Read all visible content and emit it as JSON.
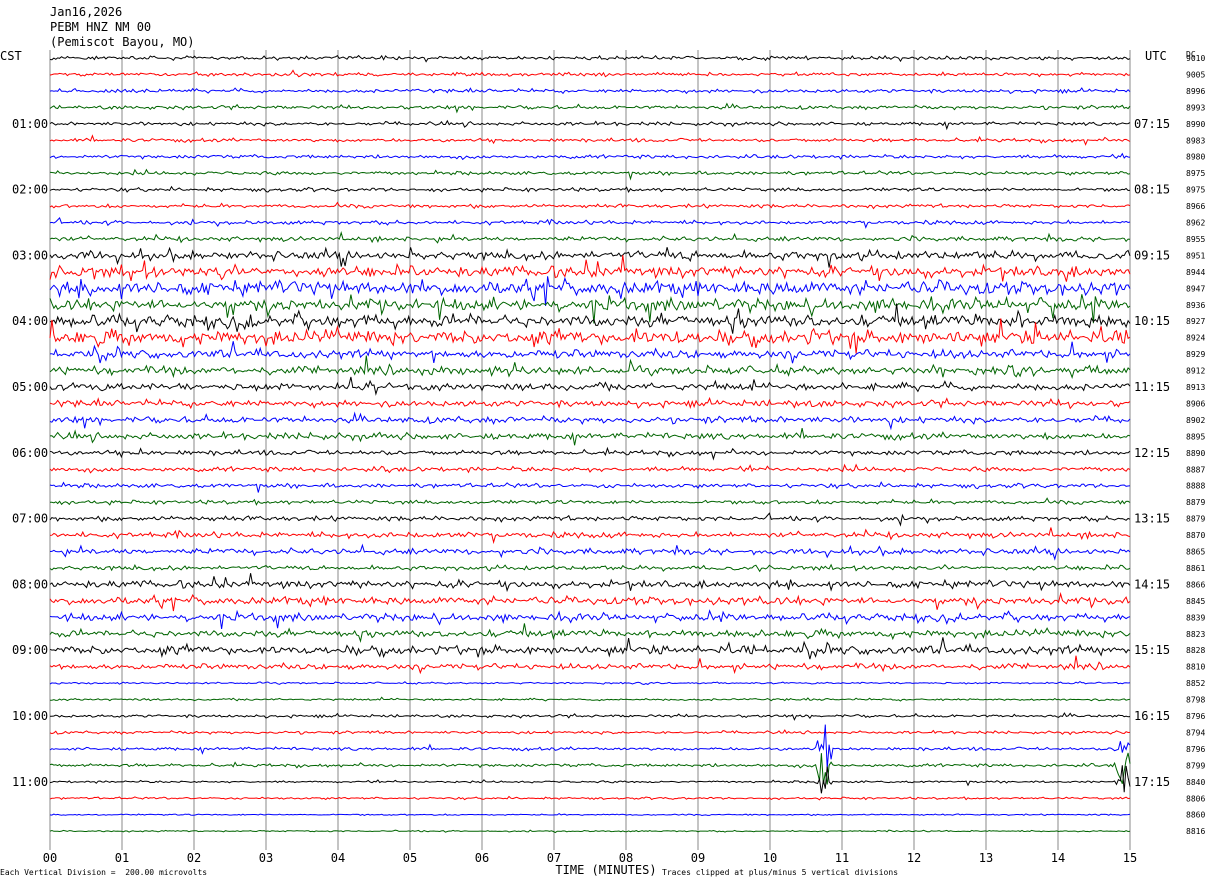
{
  "header": {
    "date": "Jan16,2026",
    "station": "PEBM HNZ NM 00",
    "location": "(Pemiscot Bayou, MO)"
  },
  "left_zone": "CST",
  "right_zone": "UTC",
  "dc_label": "DC",
  "footer": {
    "scale_note": "Each Vertical Division =  200.00 microvolts",
    "clip_note": "Traces clipped at plus/minus 5 vertical divisions"
  },
  "colors": {
    "trace_cycle": [
      "#000000",
      "#ff0000",
      "#0000ff",
      "#006400"
    ],
    "grid": "#888888"
  },
  "chart_data": {
    "type": "line",
    "title": "",
    "xlabel": "TIME (MINUTES)",
    "x_ticks": [
      "00",
      "01",
      "02",
      "03",
      "04",
      "05",
      "06",
      "07",
      "08",
      "09",
      "10",
      "11",
      "12",
      "13",
      "14",
      "15"
    ],
    "xlim": [
      0,
      15
    ],
    "left_time_labels": [
      "01:00",
      "02:00",
      "03:00",
      "04:00",
      "05:00",
      "06:00",
      "07:00",
      "08:00",
      "09:00",
      "10:00",
      "11:00"
    ],
    "right_time_labels": [
      "07:15",
      "08:15",
      "09:15",
      "10:15",
      "11:15",
      "12:15",
      "13:15",
      "14:15",
      "15:15",
      "16:15",
      "17:15"
    ],
    "dc_offsets": [
      "9010",
      "9005",
      "8996",
      "8993",
      "8990",
      "8983",
      "8980",
      "8975",
      "8975",
      "8966",
      "8962",
      "8955",
      "8951",
      "8944",
      "8947",
      "8936",
      "8927",
      "8924",
      "8929",
      "8912",
      "8913",
      "8906",
      "8902",
      "8895",
      "8890",
      "8887",
      "8888",
      "8879",
      "8879",
      "8870",
      "8865",
      "8861",
      "8866",
      "8845",
      "8839",
      "8823",
      "8828",
      "8810",
      "8852",
      "8798",
      "8796",
      "8794",
      "8796",
      "8799",
      "8840",
      "8806",
      "8860",
      "8816"
    ],
    "trace_count": 48,
    "trace_interval_minutes": 15,
    "activity_levels": [
      1,
      1,
      1,
      1,
      1,
      1,
      1,
      1,
      1,
      1,
      1.1,
      1.3,
      2.4,
      3.0,
      3.8,
      3.2,
      3.4,
      3.8,
      2.4,
      2.2,
      2.0,
      1.8,
      1.8,
      1.8,
      1.4,
      1.3,
      1.2,
      1.1,
      1.3,
      1.6,
      1.7,
      1.3,
      2.0,
      2.2,
      2.0,
      2.0,
      2.4,
      1.6,
      0.5,
      0.6,
      0.8,
      0.8,
      0.9,
      0.9,
      0.6,
      0.6,
      0.4,
      0.4
    ],
    "events": [
      {
        "trace": 42,
        "minute": 10.75,
        "note": "clipped"
      },
      {
        "trace": 43,
        "minute": 10.75,
        "note": "clipped"
      },
      {
        "trace": 44,
        "minute": 10.75,
        "note": "clipped"
      },
      {
        "trace": 42,
        "minute": 14.9,
        "note": "clipped"
      },
      {
        "trace": 43,
        "minute": 14.9,
        "note": "clipped"
      },
      {
        "trace": 44,
        "minute": 14.9,
        "note": "clipped"
      }
    ]
  }
}
